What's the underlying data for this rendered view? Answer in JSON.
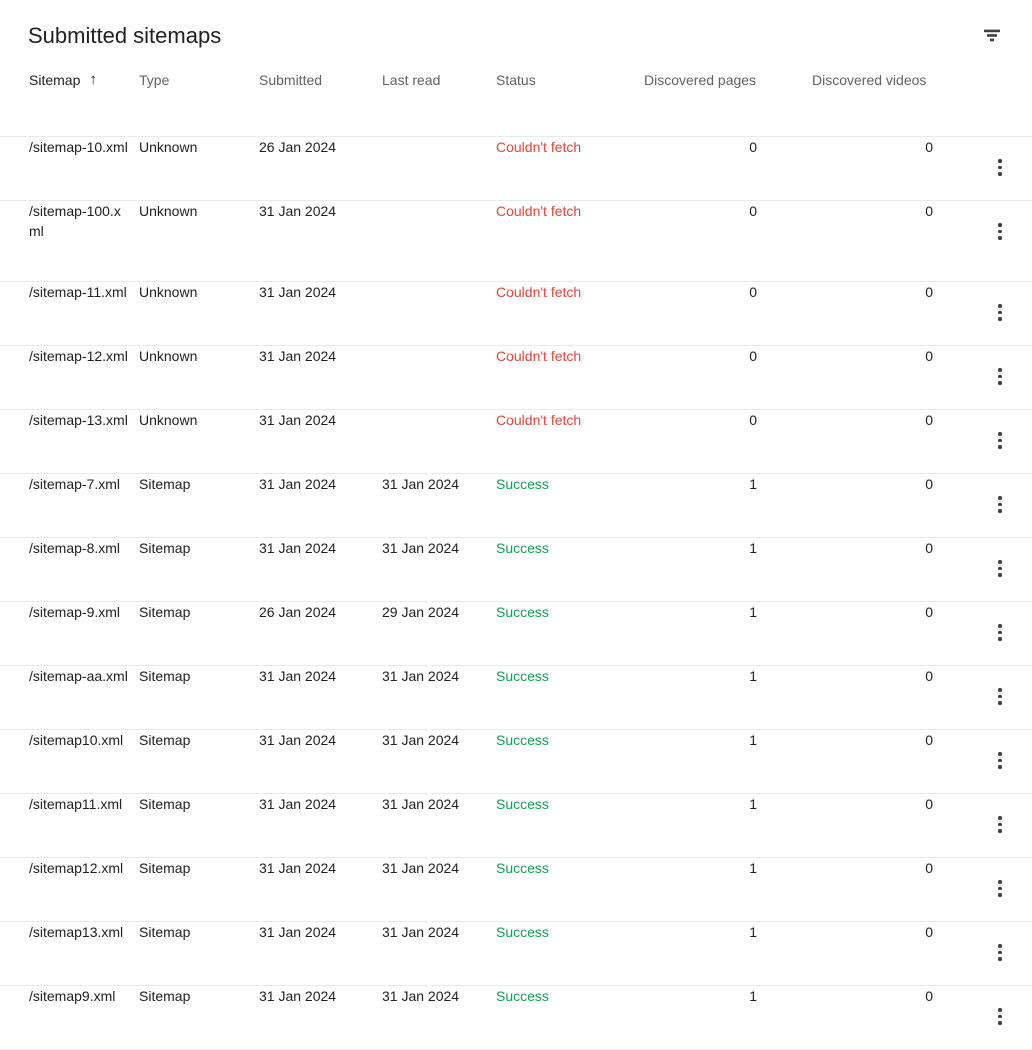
{
  "header": {
    "title": "Submitted sitemaps",
    "filter_icon": "filter-list-icon"
  },
  "table": {
    "columns": [
      {
        "key": "sitemap",
        "label": "Sitemap",
        "sorted": true,
        "sort_dir": "asc",
        "sort_icon": "arrow-up-icon"
      },
      {
        "key": "type",
        "label": "Type"
      },
      {
        "key": "submitted",
        "label": "Submitted"
      },
      {
        "key": "lastread",
        "label": "Last read"
      },
      {
        "key": "status",
        "label": "Status"
      },
      {
        "key": "pages",
        "label": "Discovered pages"
      },
      {
        "key": "videos",
        "label": "Discovered videos"
      },
      {
        "key": "menu",
        "label": ""
      }
    ],
    "status_colors": {
      "error": "#e5453a",
      "success": "#12a150"
    },
    "row_menu_icon": "more-vert-icon",
    "rows": [
      {
        "sitemap": "/sitemap-10.xml",
        "type": "Unknown",
        "submitted": "26 Jan 2024",
        "lastread": "",
        "status": "Couldn't fetch",
        "status_kind": "error",
        "pages": "0",
        "videos": "0"
      },
      {
        "sitemap": "/sitemap-100.xml",
        "type": "Unknown",
        "submitted": "31 Jan 2024",
        "lastread": "",
        "status": "Couldn't fetch",
        "status_kind": "error",
        "pages": "0",
        "videos": "0",
        "wrap": true
      },
      {
        "sitemap": "/sitemap-11.xml",
        "type": "Unknown",
        "submitted": "31 Jan 2024",
        "lastread": "",
        "status": "Couldn't fetch",
        "status_kind": "error",
        "pages": "0",
        "videos": "0"
      },
      {
        "sitemap": "/sitemap-12.xml",
        "type": "Unknown",
        "submitted": "31 Jan 2024",
        "lastread": "",
        "status": "Couldn't fetch",
        "status_kind": "error",
        "pages": "0",
        "videos": "0"
      },
      {
        "sitemap": "/sitemap-13.xml",
        "type": "Unknown",
        "submitted": "31 Jan 2024",
        "lastread": "",
        "status": "Couldn't fetch",
        "status_kind": "error",
        "pages": "0",
        "videos": "0"
      },
      {
        "sitemap": "/sitemap-7.xml",
        "type": "Sitemap",
        "submitted": "31 Jan 2024",
        "lastread": "31 Jan 2024",
        "status": "Success",
        "status_kind": "success",
        "pages": "1",
        "videos": "0"
      },
      {
        "sitemap": "/sitemap-8.xml",
        "type": "Sitemap",
        "submitted": "31 Jan 2024",
        "lastread": "31 Jan 2024",
        "status": "Success",
        "status_kind": "success",
        "pages": "1",
        "videos": "0"
      },
      {
        "sitemap": "/sitemap-9.xml",
        "type": "Sitemap",
        "submitted": "26 Jan 2024",
        "lastread": "29 Jan 2024",
        "status": "Success",
        "status_kind": "success",
        "pages": "1",
        "videos": "0"
      },
      {
        "sitemap": "/sitemap-aa.xml",
        "type": "Sitemap",
        "submitted": "31 Jan 2024",
        "lastread": "31 Jan 2024",
        "status": "Success",
        "status_kind": "success",
        "pages": "1",
        "videos": "0"
      },
      {
        "sitemap": "/sitemap10.xml",
        "type": "Sitemap",
        "submitted": "31 Jan 2024",
        "lastread": "31 Jan 2024",
        "status": "Success",
        "status_kind": "success",
        "pages": "1",
        "videos": "0"
      },
      {
        "sitemap": "/sitemap11.xml",
        "type": "Sitemap",
        "submitted": "31 Jan 2024",
        "lastread": "31 Jan 2024",
        "status": "Success",
        "status_kind": "success",
        "pages": "1",
        "videos": "0"
      },
      {
        "sitemap": "/sitemap12.xml",
        "type": "Sitemap",
        "submitted": "31 Jan 2024",
        "lastread": "31 Jan 2024",
        "status": "Success",
        "status_kind": "success",
        "pages": "1",
        "videos": "0"
      },
      {
        "sitemap": "/sitemap13.xml",
        "type": "Sitemap",
        "submitted": "31 Jan 2024",
        "lastread": "31 Jan 2024",
        "status": "Success",
        "status_kind": "success",
        "pages": "1",
        "videos": "0"
      },
      {
        "sitemap": "/sitemap9.xml",
        "type": "Sitemap",
        "submitted": "31 Jan 2024",
        "lastread": "31 Jan 2024",
        "status": "Success",
        "status_kind": "success",
        "pages": "1",
        "videos": "0"
      }
    ]
  }
}
